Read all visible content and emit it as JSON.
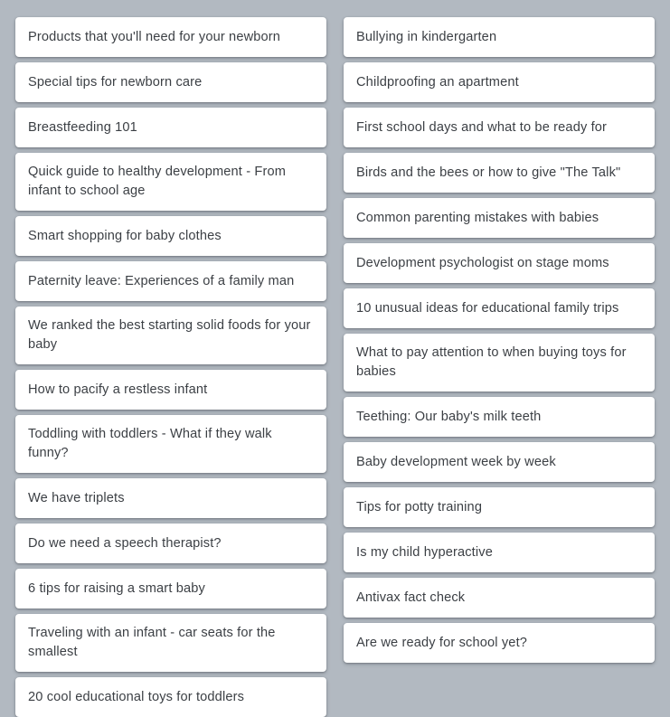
{
  "board": {
    "background_color": "#b2b9c1",
    "card_background_color": "#ffffff",
    "card_text_color": "#3b3f44",
    "columns": [
      {
        "name": "left-column",
        "cards": [
          {
            "label": "Products that you'll need for your newborn"
          },
          {
            "label": "Special tips for newborn care"
          },
          {
            "label": "Breastfeeding 101"
          },
          {
            "label": "Quick guide to healthy development - From infant to school age"
          },
          {
            "label": "Smart shopping for baby clothes"
          },
          {
            "label": "Paternity leave: Experiences of a family man"
          },
          {
            "label": "We ranked the best starting solid foods for your baby"
          },
          {
            "label": "How to pacify a restless infant"
          },
          {
            "label": "Toddling with toddlers - What if they walk funny?"
          },
          {
            "label": "We have triplets"
          },
          {
            "label": "Do we need a speech therapist?"
          },
          {
            "label": "6 tips for raising a smart baby"
          },
          {
            "label": "Traveling with an infant - car seats for the smallest"
          },
          {
            "label": "20 cool educational toys for toddlers"
          }
        ]
      },
      {
        "name": "right-column",
        "cards": [
          {
            "label": "Bullying in kindergarten"
          },
          {
            "label": "Childproofing an apartment"
          },
          {
            "label": "First school days and what to be ready for"
          },
          {
            "label": "Birds and the bees or how to give \"The Talk\""
          },
          {
            "label": "Common parenting mistakes with babies"
          },
          {
            "label": "Development psychologist on stage moms"
          },
          {
            "label": "10 unusual ideas for educational family trips"
          },
          {
            "label": "What to pay attention to when buying toys for babies"
          },
          {
            "label": "Teething: Our baby's milk teeth"
          },
          {
            "label": "Baby development week by week"
          },
          {
            "label": "Tips for potty training"
          },
          {
            "label": "Is my child hyperactive"
          },
          {
            "label": "Antivax fact check"
          },
          {
            "label": "Are we ready for school yet?"
          }
        ]
      }
    ]
  }
}
